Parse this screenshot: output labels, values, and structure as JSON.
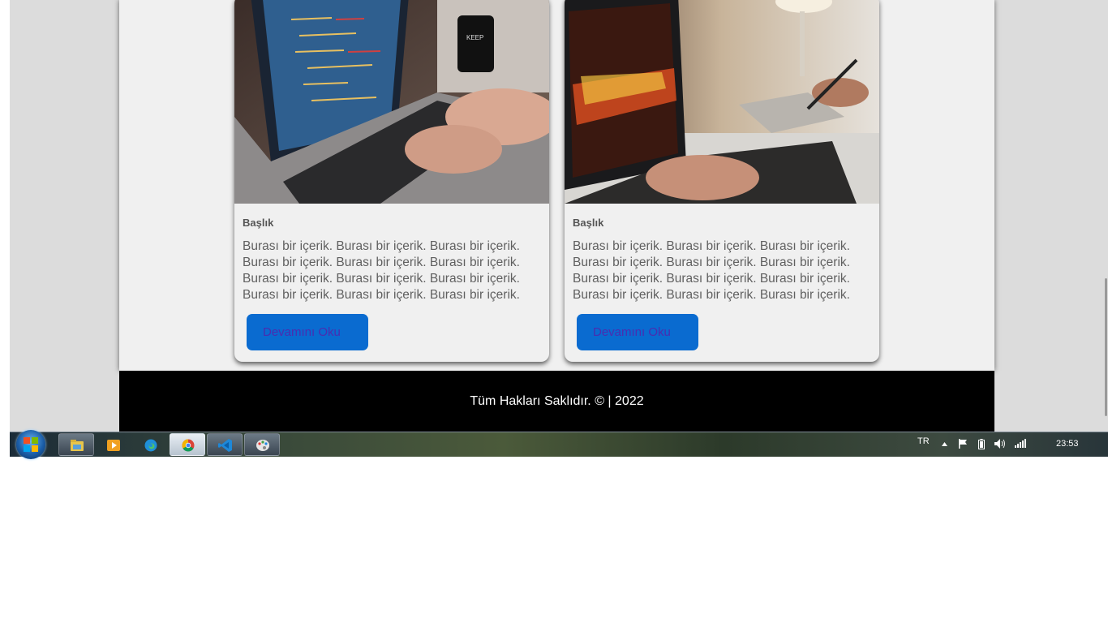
{
  "cards": [
    {
      "image": "laptop-coding-photo",
      "title": "Başlık",
      "body": "Burası bir içerik. Burası bir içerik. Burası bir içerik. Burası bir içerik. Burası bir içerik. Burası bir içerik. Burası bir içerik. Burası bir içerik. Burası bir içerik. Burası bir içerik. Burası bir içerik. Burası bir içerik.",
      "button": "Devamını Oku"
    },
    {
      "image": "laptop-design-tablet-photo",
      "title": "Başlık",
      "body": "Burası bir içerik. Burası bir içerik. Burası bir içerik. Burası bir içerik. Burası bir içerik. Burası bir içerik. Burası bir içerik. Burası bir içerik. Burası bir içerik. Burası bir içerik. Burası bir içerik. Burası bir içerik.",
      "button": "Devamını Oku"
    }
  ],
  "footer": {
    "text": "Tüm Hakları Saklıdır. © | 2022"
  },
  "colors": {
    "accent": "#0a6bd0",
    "button_text": "#4a2db0",
    "footer_bg": "#000000",
    "card_bg": "#f0f0f0"
  },
  "taskbar": {
    "apps": [
      {
        "icon": "file-explorer-icon"
      },
      {
        "icon": "media-player-icon"
      },
      {
        "icon": "edge-icon"
      },
      {
        "icon": "chrome-icon"
      },
      {
        "icon": "vscode-icon"
      },
      {
        "icon": "paint-icon"
      }
    ],
    "tray": {
      "language": "TR",
      "icons": [
        "show-hidden-icons-icon",
        "action-center-flag-icon",
        "battery-icon",
        "volume-icon",
        "network-signal-icon"
      ],
      "time": "23:53"
    }
  }
}
